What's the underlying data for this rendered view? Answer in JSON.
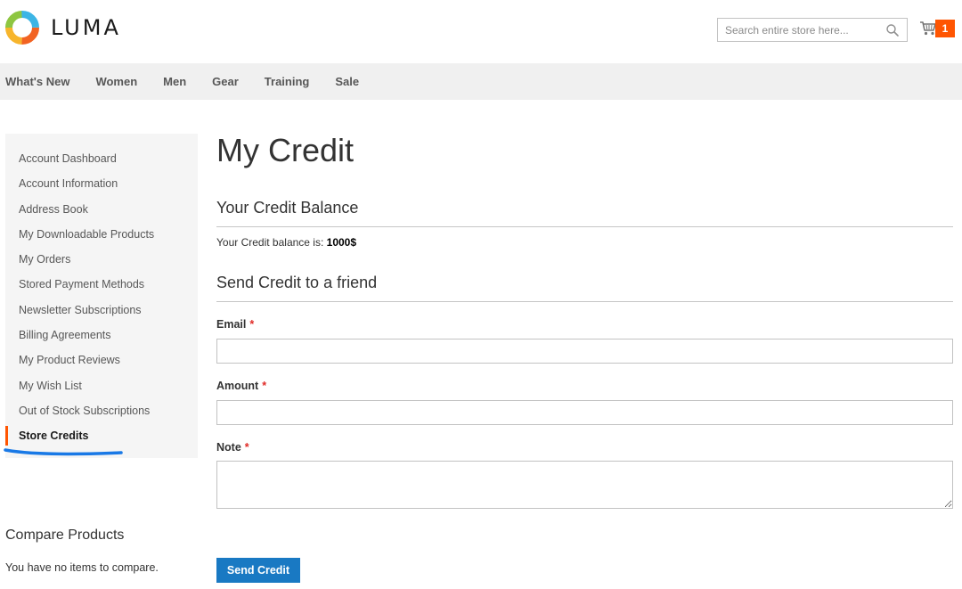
{
  "header": {
    "brand": "LUMA",
    "logo_icon": "luma-logo-icon",
    "search": {
      "placeholder": "Search entire store here...",
      "value": "",
      "icon": "search-icon"
    },
    "cart": {
      "count": "1",
      "icon": "cart-icon",
      "badge_color": "#ff5501"
    }
  },
  "nav": {
    "items": [
      "What's New",
      "Women",
      "Men",
      "Gear",
      "Training",
      "Sale"
    ]
  },
  "sidebar": {
    "items": [
      "Account Dashboard",
      "Account Information",
      "Address Book",
      "My Downloadable Products",
      "My Orders",
      "Stored Payment Methods",
      "Newsletter Subscriptions",
      "Billing Agreements",
      "My Product Reviews",
      "My Wish List",
      "Out of Stock Subscriptions",
      "Store Credits"
    ],
    "current": "Store Credits",
    "accent_color": "#ff5501",
    "annotation_color": "#1979e6"
  },
  "compare": {
    "title": "Compare Products",
    "empty_text": "You have no items to compare."
  },
  "main": {
    "title": "My Credit",
    "balance_section": {
      "title": "Your Credit Balance",
      "label": "Your Credit balance is:",
      "value": "1000$"
    },
    "send_section": {
      "title": "Send Credit to a friend",
      "required_mark": "*",
      "fields": {
        "email": {
          "label": "Email",
          "value": ""
        },
        "amount": {
          "label": "Amount",
          "value": ""
        },
        "note": {
          "label": "Note",
          "value": ""
        }
      },
      "submit_label": "Send Credit",
      "button_color": "#1979c3"
    }
  }
}
